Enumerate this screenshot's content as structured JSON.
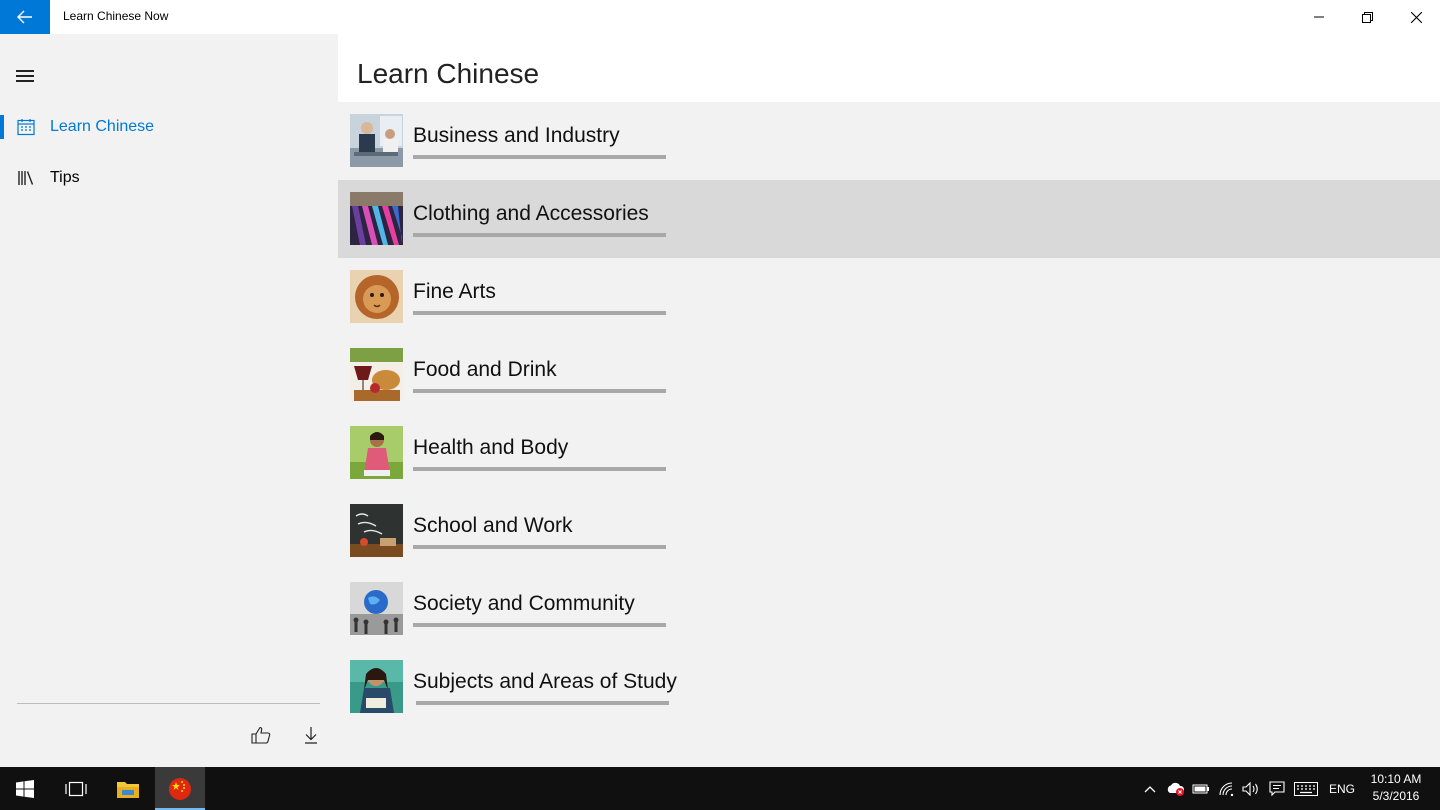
{
  "window": {
    "title": "Learn Chinese Now",
    "accent": "#0078d7"
  },
  "nav": {
    "items": [
      {
        "label": "Learn Chinese",
        "icon": "calendar-icon",
        "active": true
      },
      {
        "label": "Tips",
        "icon": "library-icon",
        "active": false
      }
    ],
    "footer": {
      "like_icon": "thumbs-up-icon",
      "download_icon": "download-icon"
    }
  },
  "main": {
    "title": "Learn Chinese",
    "categories": [
      {
        "label": "Business and Industry",
        "selected": false
      },
      {
        "label": "Clothing and Accessories",
        "selected": true
      },
      {
        "label": "Fine Arts",
        "selected": false
      },
      {
        "label": "Food and Drink",
        "selected": false
      },
      {
        "label": "Health and Body",
        "selected": false
      },
      {
        "label": "School and Work",
        "selected": false
      },
      {
        "label": "Society and Community",
        "selected": false
      },
      {
        "label": "Subjects and Areas of Study",
        "selected": false
      }
    ]
  },
  "taskbar": {
    "language": "ENG",
    "time": "10:10 AM",
    "date": "5/3/2016"
  }
}
